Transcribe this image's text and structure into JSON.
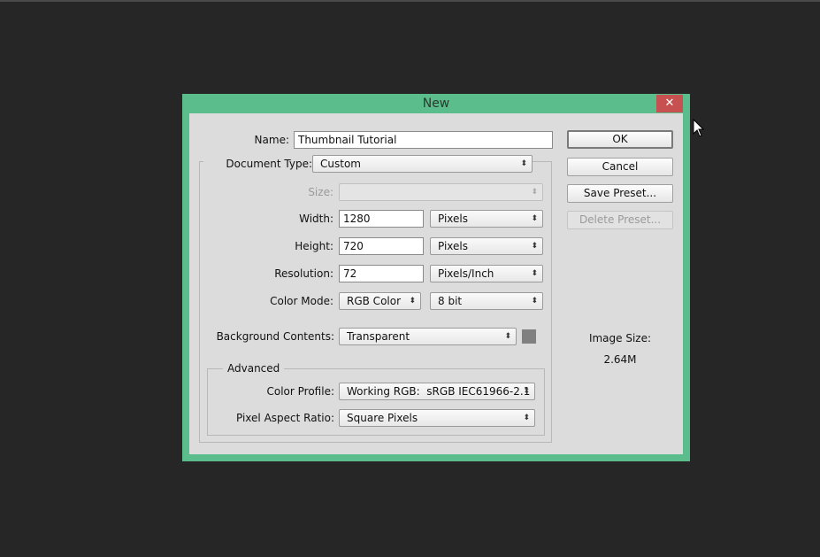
{
  "dialog": {
    "title": "New",
    "close": "✕"
  },
  "name": {
    "label": "Name:",
    "value": "Thumbnail Tutorial"
  },
  "document_type": {
    "label": "Document Type:",
    "value": "Custom"
  },
  "size": {
    "label": "Size:",
    "value": ""
  },
  "width": {
    "label": "Width:",
    "value": "1280",
    "unit": "Pixels"
  },
  "height": {
    "label": "Height:",
    "value": "720",
    "unit": "Pixels"
  },
  "resolution": {
    "label": "Resolution:",
    "value": "72",
    "unit": "Pixels/Inch"
  },
  "color_mode": {
    "label": "Color Mode:",
    "value": "RGB Color",
    "depth": "8 bit"
  },
  "background": {
    "label": "Background Contents:",
    "value": "Transparent",
    "swatch_color": "#808080"
  },
  "advanced": {
    "legend": "Advanced",
    "color_profile_label": "Color Profile:",
    "color_profile": "Working RGB:  sRGB IEC61966-2.1",
    "par_label": "Pixel Aspect Ratio:",
    "par": "Square Pixels"
  },
  "buttons": {
    "ok": "OK",
    "cancel": "Cancel",
    "save_preset": "Save Preset...",
    "delete_preset": "Delete Preset..."
  },
  "image_size": {
    "label": "Image Size:",
    "value": "2.64M"
  },
  "arrow": "⬍"
}
